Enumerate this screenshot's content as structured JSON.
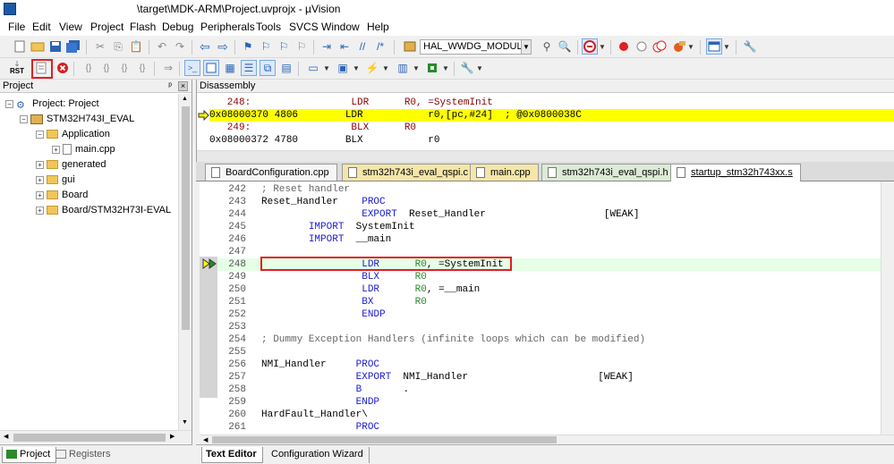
{
  "window": {
    "title": "\\target\\MDK-ARM\\Project.uvprojx - µVision"
  },
  "menu": [
    "File",
    "Edit",
    "View",
    "Project",
    "Flash",
    "Debug",
    "Peripherals",
    "Tools",
    "SVCS",
    "Window",
    "Help"
  ],
  "toolbar": {
    "target_combo": "HAL_WWDG_MODULE_EI",
    "reset_label": "RST"
  },
  "project_panel": {
    "title": "Project",
    "root": "Project: Project",
    "target": "STM32H743I_EVAL",
    "groups": [
      "Application",
      "generated",
      "gui",
      "Board",
      "Board/STM32H73I-EVAL"
    ],
    "application_files": [
      "main.cpp"
    ],
    "tabs": [
      "Project",
      "Registers"
    ]
  },
  "disassembly": {
    "title": "Disassembly",
    "lines": [
      "   248:                 LDR      R0, =SystemInit",
      "0x08000370 4806        LDR           r0,[pc,#24]  ; @0x0800038C",
      "   249:                 BLX      R0",
      "0x08000372 4780        BLX           r0"
    ]
  },
  "editor": {
    "tabs": [
      "BoardConfiguration.cpp",
      "stm32h743i_eval_qspi.c",
      "main.cpp",
      "stm32h743i_eval_qspi.h",
      "startup_stm32h743xx.s"
    ],
    "active_tab": "startup_stm32h743xx.s",
    "lines": [
      {
        "n": "242",
        "code": "; Reset handler"
      },
      {
        "n": "243",
        "code": "Reset_Handler    PROC"
      },
      {
        "n": "244",
        "code": "                 EXPORT  Reset_Handler                    [WEAK]"
      },
      {
        "n": "245",
        "code": "        IMPORT  SystemInit"
      },
      {
        "n": "246",
        "code": "        IMPORT  __main"
      },
      {
        "n": "247",
        "code": ""
      },
      {
        "n": "248",
        "code": "                 LDR      R0, =SystemInit"
      },
      {
        "n": "249",
        "code": "                 BLX      R0"
      },
      {
        "n": "250",
        "code": "                 LDR      R0, =__main"
      },
      {
        "n": "251",
        "code": "                 BX       R0"
      },
      {
        "n": "252",
        "code": "                 ENDP"
      },
      {
        "n": "253",
        "code": ""
      },
      {
        "n": "254",
        "code": "; Dummy Exception Handlers (infinite loops which can be modified)"
      },
      {
        "n": "255",
        "code": ""
      },
      {
        "n": "256",
        "code": "NMI_Handler     PROC"
      },
      {
        "n": "257",
        "code": "                EXPORT  NMI_Handler                      [WEAK]"
      },
      {
        "n": "258",
        "code": "                B       ."
      },
      {
        "n": "259",
        "code": "                ENDP"
      },
      {
        "n": "260",
        "code": "HardFault_Handler\\"
      },
      {
        "n": "261",
        "code": "                PROC"
      }
    ],
    "bottom_tabs": [
      "Text Editor",
      "Configuration Wizard"
    ]
  },
  "colors": {
    "highlight_yellow": "#ffff00",
    "current_line": "#e6ffe6",
    "annotation_red": "#e02020"
  }
}
